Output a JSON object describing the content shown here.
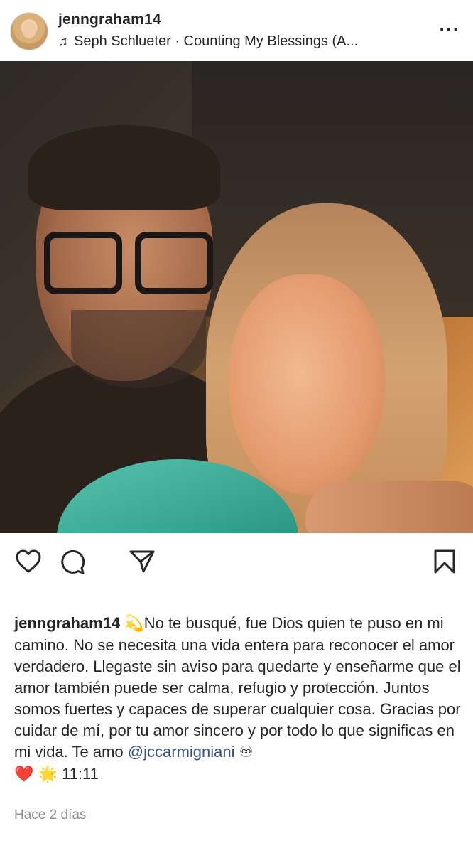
{
  "post": {
    "username": "jenngraham14",
    "music": {
      "note_icon": "music-note-icon",
      "text": "Seph Schlueter · Counting My Blessings (A..."
    },
    "more_icon": "more-options-icon"
  },
  "media": {
    "mute_icon": "mute-audio-icon"
  },
  "actions": {
    "like_icon": "heart-icon",
    "comment_icon": "comment-icon",
    "share_icon": "send-icon",
    "save_icon": "bookmark-icon"
  },
  "caption": {
    "username": "jenngraham14",
    "lead_emoji": "💫",
    "text": "No te busqué, fue Dios quien te puso en mi camino. No se necesita una vida entera para reconocer el amor verdadero. Llegaste sin aviso para quedarte y enseñarme que el amor también puede ser calma, refugio y protección. Juntos somos fuertes y capaces de superar cualquier cosa. Gracias por cuidar de mí, por tu amor sincero y por todo lo que significas en mi vida. Te amo",
    "mention": "@jccarmigniani",
    "infinity": "♾",
    "heart": "❤️",
    "star": "🌟",
    "time_text": "11:11"
  },
  "timestamp": "Hace 2 días"
}
